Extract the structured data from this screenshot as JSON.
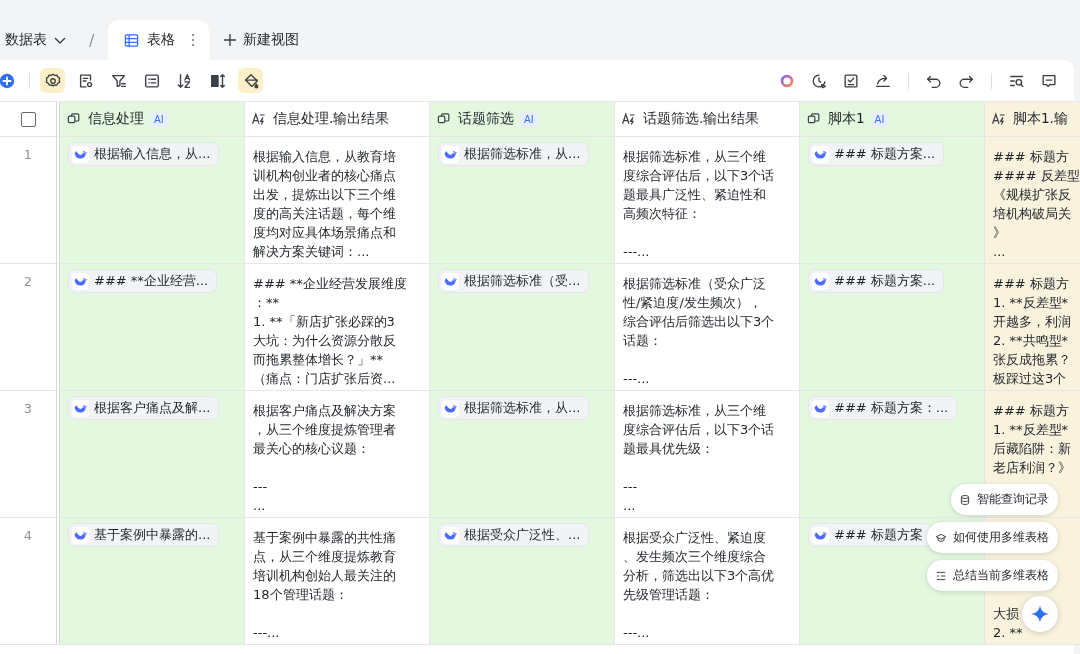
{
  "tabs": {
    "table_switcher": "数据表",
    "separator": "/",
    "views": [
      {
        "label": "表格",
        "selected": true
      }
    ],
    "add_view": "新建视图"
  },
  "toolbar": {
    "left": [
      {
        "kind": "add",
        "active": false
      },
      {
        "kind": "settings",
        "active": true
      },
      {
        "kind": "form",
        "active": false
      },
      {
        "kind": "filter",
        "active": false
      },
      {
        "kind": "list",
        "active": false
      },
      {
        "kind": "sort",
        "active": false
      },
      {
        "kind": "height",
        "active": false
      },
      {
        "kind": "paint",
        "active": true
      }
    ],
    "right": [
      {
        "kind": "orb"
      },
      {
        "kind": "history"
      },
      {
        "kind": "check"
      },
      {
        "kind": "share"
      },
      {
        "kind": "sep"
      },
      {
        "kind": "undo"
      },
      {
        "kind": "redo"
      },
      {
        "kind": "sep"
      },
      {
        "kind": "find"
      },
      {
        "kind": "comment"
      }
    ]
  },
  "table": {
    "select_all_checked": false,
    "columns": [
      {
        "label": "信息处理",
        "kind": "ai",
        "ai_badge": "AI"
      },
      {
        "label": "信息处理.输出结果",
        "kind": "output"
      },
      {
        "label": "话题筛选",
        "kind": "ai",
        "ai_badge": "AI"
      },
      {
        "label": "话题筛选.输出结果",
        "kind": "output"
      },
      {
        "label": "脚本1",
        "kind": "ai",
        "ai_badge": "AI"
      },
      {
        "label": "脚本1.输",
        "kind": "output_partial"
      }
    ],
    "rows": [
      {
        "number": "1",
        "cells": [
          [
            [
              "根据输入信息，从..."
            ]
          ],
          [
            [
              "根据输入信息，从教育培",
              "训机构创业者的核心痛点",
              "出发，提炼出以下三个维",
              "度的高关注话题，每个维",
              "度均对应具体场景痛点和",
              "解决方案关键词：..."
            ]
          ],
          [
            [
              "根据筛选标准，从..."
            ]
          ],
          [
            [
              "根据筛选标准，从三个维",
              "度综合评估后，以下3个话",
              "题最具广泛性、紧迫性和",
              "高频次特征："
            ],
            [
              "---..."
            ]
          ],
          [
            [
              "### 标题方案..."
            ]
          ],
          [
            [
              "### 标题方",
              "#### 反差型",
              "《规模扩张反",
              "培机构破局关",
              "》",
              "..."
            ]
          ]
        ]
      },
      {
        "number": "2",
        "cells": [
          [
            [
              "### **企业经营..."
            ]
          ],
          [
            [
              "### **企业经营发展维度",
              "：**",
              "1. **「新店扩张必踩的3",
              "大坑：为什么资源分散反",
              "而拖累整体增长？」**",
              "（痛点：门店扩张后资..."
            ]
          ],
          [
            [
              "根据筛选标准（受..."
            ]
          ],
          [
            [
              "根据筛选标准（受众广泛",
              "性/紧迫度/发生频次），",
              "综合评估后筛选出以下3个",
              "话题："
            ],
            [
              "---..."
            ]
          ],
          [
            [
              "### 标题方案..."
            ]
          ],
          [
            [
              "### 标题方",
              "1. **反差型*",
              "开越多，利润",
              "2. **共鸣型*",
              "张反成拖累？",
              "板踩过这3个"
            ]
          ]
        ]
      },
      {
        "number": "3",
        "cells": [
          [
            [
              "根据客户痛点及解..."
            ]
          ],
          [
            [
              "根据客户痛点及解决方案",
              "，从三个维度提炼管理者",
              "最关心的核心议题："
            ],
            [
              "---",
              "..."
            ]
          ],
          [
            [
              "根据筛选标准，从..."
            ]
          ],
          [
            [
              "根据筛选标准，从三个维",
              "度综合评估后，以下3个话",
              "题最具优先级："
            ],
            [
              "---",
              "..."
            ]
          ],
          [
            [
              "### 标题方案：..."
            ]
          ],
          [
            [
              "### 标题方",
              "1. **反差型*",
              "后藏陷阱：新",
              "老店利润？》"
            ]
          ]
        ]
      },
      {
        "number": "4",
        "cells": [
          [
            [
              "基于案例中暴露的..."
            ]
          ],
          [
            [
              "基于案例中暴露的共性痛",
              "点，从三个维度提炼教育",
              "培训机构创始人最关注的",
              "18个管理话题："
            ],
            [
              "---..."
            ]
          ],
          [
            [
              "根据受众广泛性、..."
            ]
          ],
          [
            [
              "根据受众广泛性、紧迫度",
              "、发生频次三个维度综合",
              "分析，筛选出以下3个高优",
              "先级管理话题："
            ],
            [
              "---..."
            ]
          ],
          [
            [
              "### 标题方案"
            ]
          ],
          [
            [
              "大损",
              "2. **"
            ]
          ]
        ]
      }
    ]
  },
  "assistant": {
    "suggestions": [
      {
        "kind": "query",
        "label": "智能查询记录"
      },
      {
        "kind": "help",
        "label": "如何使用多维表格"
      },
      {
        "kind": "summary",
        "label": "总结当前多维表格"
      }
    ]
  }
}
